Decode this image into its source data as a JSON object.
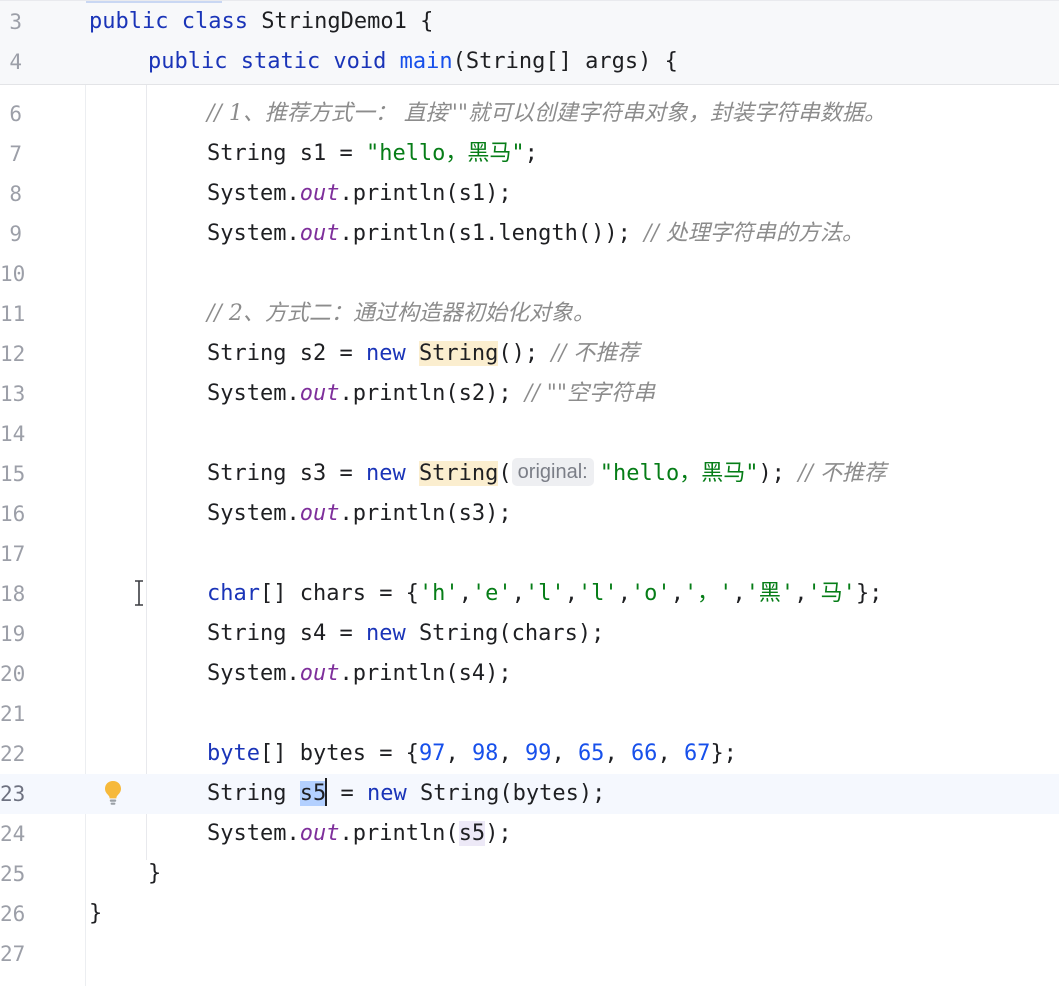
{
  "editor": {
    "sticky": [
      {
        "line": "3",
        "code": [
          {
            "t": "public class ",
            "c": "kw"
          },
          {
            "t": "StringDemo1 {",
            "c": ""
          }
        ]
      },
      {
        "line": "4",
        "code": [
          {
            "t": "public static void ",
            "c": "kw"
          },
          {
            "t": "main",
            "c": "fn"
          },
          {
            "t": "(String[] args) {",
            "c": ""
          }
        ]
      }
    ],
    "lines": [
      {
        "line": "6",
        "code": [
          {
            "t": "// 1、推荐方式一： 直接\"\"就可以创建字符串对象，封装字符串数据。",
            "c": "cmt"
          }
        ]
      },
      {
        "line": "7",
        "code": [
          {
            "t": "String s1 = ",
            "c": ""
          },
          {
            "t": "\"hello，黑马\"",
            "c": "str"
          },
          {
            "t": ";",
            "c": ""
          }
        ]
      },
      {
        "line": "8",
        "code": [
          {
            "t": "System.",
            "c": ""
          },
          {
            "t": "out",
            "c": "field"
          },
          {
            "t": ".println(s1);",
            "c": ""
          }
        ]
      },
      {
        "line": "9",
        "code": [
          {
            "t": "System.",
            "c": ""
          },
          {
            "t": "out",
            "c": "field"
          },
          {
            "t": ".println(s1.length()); ",
            "c": ""
          },
          {
            "t": "// 处理字符串的方法。",
            "c": "cmt"
          }
        ]
      },
      {
        "line": "10",
        "code": []
      },
      {
        "line": "11",
        "code": [
          {
            "t": "// 2、方式二：通过构造器初始化对象。",
            "c": "cmt"
          }
        ]
      },
      {
        "line": "12",
        "code": [
          {
            "t": "String s2 = ",
            "c": ""
          },
          {
            "t": "new ",
            "c": "kw"
          },
          {
            "t": "String",
            "c": "hl-ctor"
          },
          {
            "t": "(); ",
            "c": ""
          },
          {
            "t": "// 不推荐",
            "c": "cmt"
          }
        ]
      },
      {
        "line": "13",
        "code": [
          {
            "t": "System.",
            "c": ""
          },
          {
            "t": "out",
            "c": "field"
          },
          {
            "t": ".println(s2); ",
            "c": ""
          },
          {
            "t": "// \"\"空字符串",
            "c": "cmt"
          }
        ]
      },
      {
        "line": "14",
        "code": []
      },
      {
        "line": "15",
        "code": [
          {
            "t": "String s3 = ",
            "c": ""
          },
          {
            "t": "new ",
            "c": "kw"
          },
          {
            "t": "String",
            "c": "hl-ctor"
          },
          {
            "t": "(",
            "c": ""
          },
          {
            "t": "original:",
            "c": "hint"
          },
          {
            "t": "\"hello，黑马\"",
            "c": "str"
          },
          {
            "t": "); ",
            "c": ""
          },
          {
            "t": "// 不推荐",
            "c": "cmt"
          }
        ]
      },
      {
        "line": "16",
        "code": [
          {
            "t": "System.",
            "c": ""
          },
          {
            "t": "out",
            "c": "field"
          },
          {
            "t": ".println(s3);",
            "c": ""
          }
        ]
      },
      {
        "line": "17",
        "code": []
      },
      {
        "line": "18",
        "code": [
          {
            "t": "char",
            "c": "kw"
          },
          {
            "t": "[] chars = {",
            "c": ""
          },
          {
            "t": "'h'",
            "c": "str"
          },
          {
            "t": ",",
            "c": ""
          },
          {
            "t": "'e'",
            "c": "str"
          },
          {
            "t": ",",
            "c": ""
          },
          {
            "t": "'l'",
            "c": "str"
          },
          {
            "t": ",",
            "c": ""
          },
          {
            "t": "'l'",
            "c": "str"
          },
          {
            "t": ",",
            "c": ""
          },
          {
            "t": "'o'",
            "c": "str"
          },
          {
            "t": ",",
            "c": ""
          },
          {
            "t": "'，'",
            "c": "str"
          },
          {
            "t": ",",
            "c": ""
          },
          {
            "t": "'黑'",
            "c": "str"
          },
          {
            "t": ",",
            "c": ""
          },
          {
            "t": "'马'",
            "c": "str"
          },
          {
            "t": "};",
            "c": ""
          }
        ]
      },
      {
        "line": "19",
        "code": [
          {
            "t": "String s4 = ",
            "c": ""
          },
          {
            "t": "new ",
            "c": "kw"
          },
          {
            "t": "String(chars);",
            "c": ""
          }
        ]
      },
      {
        "line": "20",
        "code": [
          {
            "t": "System.",
            "c": ""
          },
          {
            "t": "out",
            "c": "field"
          },
          {
            "t": ".println(s4);",
            "c": ""
          }
        ]
      },
      {
        "line": "21",
        "code": []
      },
      {
        "line": "22",
        "code": [
          {
            "t": "byte",
            "c": "kw"
          },
          {
            "t": "[] bytes = {",
            "c": ""
          },
          {
            "t": "97",
            "c": "num"
          },
          {
            "t": ", ",
            "c": ""
          },
          {
            "t": "98",
            "c": "num"
          },
          {
            "t": ", ",
            "c": ""
          },
          {
            "t": "99",
            "c": "num"
          },
          {
            "t": ", ",
            "c": ""
          },
          {
            "t": "65",
            "c": "num"
          },
          {
            "t": ", ",
            "c": ""
          },
          {
            "t": "66",
            "c": "num"
          },
          {
            "t": ", ",
            "c": ""
          },
          {
            "t": "67",
            "c": "num"
          },
          {
            "t": "};",
            "c": ""
          }
        ]
      },
      {
        "line": "23",
        "current": true,
        "code": [
          {
            "t": "String ",
            "c": ""
          },
          {
            "t": "s5",
            "c": "hl-sel"
          },
          {
            "t": "",
            "c": "caret"
          },
          {
            "t": " = ",
            "c": ""
          },
          {
            "t": "new ",
            "c": "kw"
          },
          {
            "t": "String(bytes);",
            "c": ""
          }
        ]
      },
      {
        "line": "24",
        "code": [
          {
            "t": "System.",
            "c": ""
          },
          {
            "t": "out",
            "c": "field"
          },
          {
            "t": ".println(",
            "c": ""
          },
          {
            "t": "s5",
            "c": "hl-ref"
          },
          {
            "t": ");",
            "c": ""
          }
        ]
      },
      {
        "line": "25",
        "code": [
          {
            "t": "}",
            "c": ""
          }
        ]
      },
      {
        "line": "26",
        "code": [
          {
            "t": "}",
            "c": ""
          }
        ]
      },
      {
        "line": "27",
        "code": []
      }
    ],
    "intention_icon": "lightbulb-icon",
    "cursor_icon": "text-cursor-icon"
  }
}
